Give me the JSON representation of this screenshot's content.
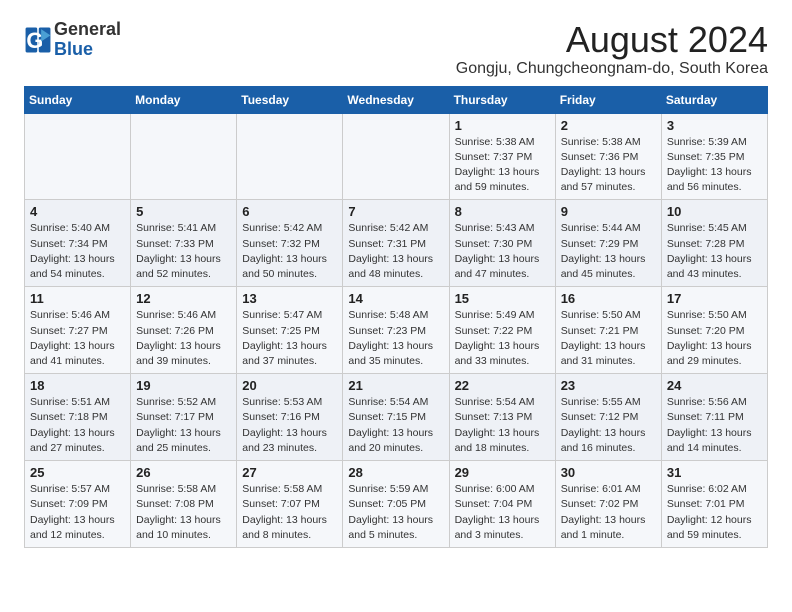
{
  "header": {
    "logo_line1": "General",
    "logo_line2": "Blue",
    "month": "August 2024",
    "location": "Gongju, Chungcheongnam-do, South Korea"
  },
  "weekdays": [
    "Sunday",
    "Monday",
    "Tuesday",
    "Wednesday",
    "Thursday",
    "Friday",
    "Saturday"
  ],
  "weeks": [
    [
      {
        "day": "",
        "info": ""
      },
      {
        "day": "",
        "info": ""
      },
      {
        "day": "",
        "info": ""
      },
      {
        "day": "",
        "info": ""
      },
      {
        "day": "1",
        "info": "Sunrise: 5:38 AM\nSunset: 7:37 PM\nDaylight: 13 hours\nand 59 minutes."
      },
      {
        "day": "2",
        "info": "Sunrise: 5:38 AM\nSunset: 7:36 PM\nDaylight: 13 hours\nand 57 minutes."
      },
      {
        "day": "3",
        "info": "Sunrise: 5:39 AM\nSunset: 7:35 PM\nDaylight: 13 hours\nand 56 minutes."
      }
    ],
    [
      {
        "day": "4",
        "info": "Sunrise: 5:40 AM\nSunset: 7:34 PM\nDaylight: 13 hours\nand 54 minutes."
      },
      {
        "day": "5",
        "info": "Sunrise: 5:41 AM\nSunset: 7:33 PM\nDaylight: 13 hours\nand 52 minutes."
      },
      {
        "day": "6",
        "info": "Sunrise: 5:42 AM\nSunset: 7:32 PM\nDaylight: 13 hours\nand 50 minutes."
      },
      {
        "day": "7",
        "info": "Sunrise: 5:42 AM\nSunset: 7:31 PM\nDaylight: 13 hours\nand 48 minutes."
      },
      {
        "day": "8",
        "info": "Sunrise: 5:43 AM\nSunset: 7:30 PM\nDaylight: 13 hours\nand 47 minutes."
      },
      {
        "day": "9",
        "info": "Sunrise: 5:44 AM\nSunset: 7:29 PM\nDaylight: 13 hours\nand 45 minutes."
      },
      {
        "day": "10",
        "info": "Sunrise: 5:45 AM\nSunset: 7:28 PM\nDaylight: 13 hours\nand 43 minutes."
      }
    ],
    [
      {
        "day": "11",
        "info": "Sunrise: 5:46 AM\nSunset: 7:27 PM\nDaylight: 13 hours\nand 41 minutes."
      },
      {
        "day": "12",
        "info": "Sunrise: 5:46 AM\nSunset: 7:26 PM\nDaylight: 13 hours\nand 39 minutes."
      },
      {
        "day": "13",
        "info": "Sunrise: 5:47 AM\nSunset: 7:25 PM\nDaylight: 13 hours\nand 37 minutes."
      },
      {
        "day": "14",
        "info": "Sunrise: 5:48 AM\nSunset: 7:23 PM\nDaylight: 13 hours\nand 35 minutes."
      },
      {
        "day": "15",
        "info": "Sunrise: 5:49 AM\nSunset: 7:22 PM\nDaylight: 13 hours\nand 33 minutes."
      },
      {
        "day": "16",
        "info": "Sunrise: 5:50 AM\nSunset: 7:21 PM\nDaylight: 13 hours\nand 31 minutes."
      },
      {
        "day": "17",
        "info": "Sunrise: 5:50 AM\nSunset: 7:20 PM\nDaylight: 13 hours\nand 29 minutes."
      }
    ],
    [
      {
        "day": "18",
        "info": "Sunrise: 5:51 AM\nSunset: 7:18 PM\nDaylight: 13 hours\nand 27 minutes."
      },
      {
        "day": "19",
        "info": "Sunrise: 5:52 AM\nSunset: 7:17 PM\nDaylight: 13 hours\nand 25 minutes."
      },
      {
        "day": "20",
        "info": "Sunrise: 5:53 AM\nSunset: 7:16 PM\nDaylight: 13 hours\nand 23 minutes."
      },
      {
        "day": "21",
        "info": "Sunrise: 5:54 AM\nSunset: 7:15 PM\nDaylight: 13 hours\nand 20 minutes."
      },
      {
        "day": "22",
        "info": "Sunrise: 5:54 AM\nSunset: 7:13 PM\nDaylight: 13 hours\nand 18 minutes."
      },
      {
        "day": "23",
        "info": "Sunrise: 5:55 AM\nSunset: 7:12 PM\nDaylight: 13 hours\nand 16 minutes."
      },
      {
        "day": "24",
        "info": "Sunrise: 5:56 AM\nSunset: 7:11 PM\nDaylight: 13 hours\nand 14 minutes."
      }
    ],
    [
      {
        "day": "25",
        "info": "Sunrise: 5:57 AM\nSunset: 7:09 PM\nDaylight: 13 hours\nand 12 minutes."
      },
      {
        "day": "26",
        "info": "Sunrise: 5:58 AM\nSunset: 7:08 PM\nDaylight: 13 hours\nand 10 minutes."
      },
      {
        "day": "27",
        "info": "Sunrise: 5:58 AM\nSunset: 7:07 PM\nDaylight: 13 hours\nand 8 minutes."
      },
      {
        "day": "28",
        "info": "Sunrise: 5:59 AM\nSunset: 7:05 PM\nDaylight: 13 hours\nand 5 minutes."
      },
      {
        "day": "29",
        "info": "Sunrise: 6:00 AM\nSunset: 7:04 PM\nDaylight: 13 hours\nand 3 minutes."
      },
      {
        "day": "30",
        "info": "Sunrise: 6:01 AM\nSunset: 7:02 PM\nDaylight: 13 hours\nand 1 minute."
      },
      {
        "day": "31",
        "info": "Sunrise: 6:02 AM\nSunset: 7:01 PM\nDaylight: 12 hours\nand 59 minutes."
      }
    ]
  ]
}
